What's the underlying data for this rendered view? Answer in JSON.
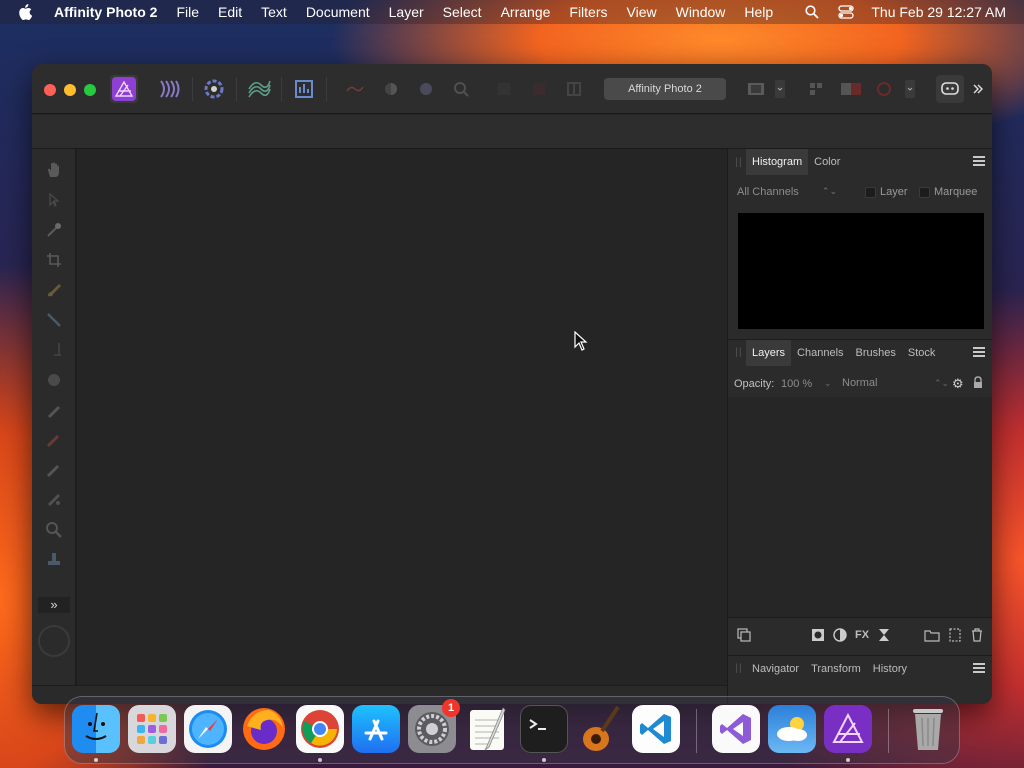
{
  "menubar": {
    "app_name": "Affinity Photo 2",
    "items": [
      "File",
      "Edit",
      "Text",
      "Document",
      "Layer",
      "Select",
      "Arrange",
      "Filters",
      "View",
      "Window",
      "Help"
    ],
    "clock": "Thu Feb 29  12:27 AM",
    "icons": [
      "apple-icon",
      "search-icon",
      "control-center-icon"
    ]
  },
  "window": {
    "document_title": "Affinity Photo 2",
    "toolbar_icons": [
      "photo-persona-icon",
      "liquify-persona-icon",
      "develop-persona-icon",
      "tone-mapping-persona-icon",
      "export-persona-icon",
      "more-icon"
    ],
    "tools": [
      "hand-tool-icon",
      "move-tool-icon",
      "color-picker-tool-icon",
      "crop-tool-icon",
      "paint-brush-tool-icon",
      "selection-brush-tool-icon",
      "flood-select-tool-icon",
      "clone-tool-icon",
      "brush-tool-icon",
      "dodge-tool-icon",
      "erase-tool-icon",
      "zoom-tool-icon",
      "stamp-tool-icon"
    ]
  },
  "panels": {
    "top_tabs": [
      "Histogram",
      "Color"
    ],
    "histogram": {
      "channel_select": "All Channels",
      "layer_label": "Layer",
      "marquee_label": "Marquee"
    },
    "middle_tabs": [
      "Layers",
      "Channels",
      "Brushes",
      "Stock"
    ],
    "layers": {
      "opacity_label": "Opacity:",
      "opacity_value": "100 %",
      "blend_mode": "Normal"
    },
    "bottom_tabs": [
      "Navigator",
      "Transform",
      "History"
    ]
  },
  "dock": {
    "apps": [
      "Finder",
      "Launchpad",
      "Safari",
      "Firefox",
      "Chrome",
      "App Store",
      "System Settings",
      "TextEdit",
      "Terminal",
      "GarageBand",
      "Visual Studio Code",
      "Visual Studio",
      "Weather",
      "Affinity Photo 2",
      "Trash"
    ],
    "system_settings_badge": "1"
  }
}
